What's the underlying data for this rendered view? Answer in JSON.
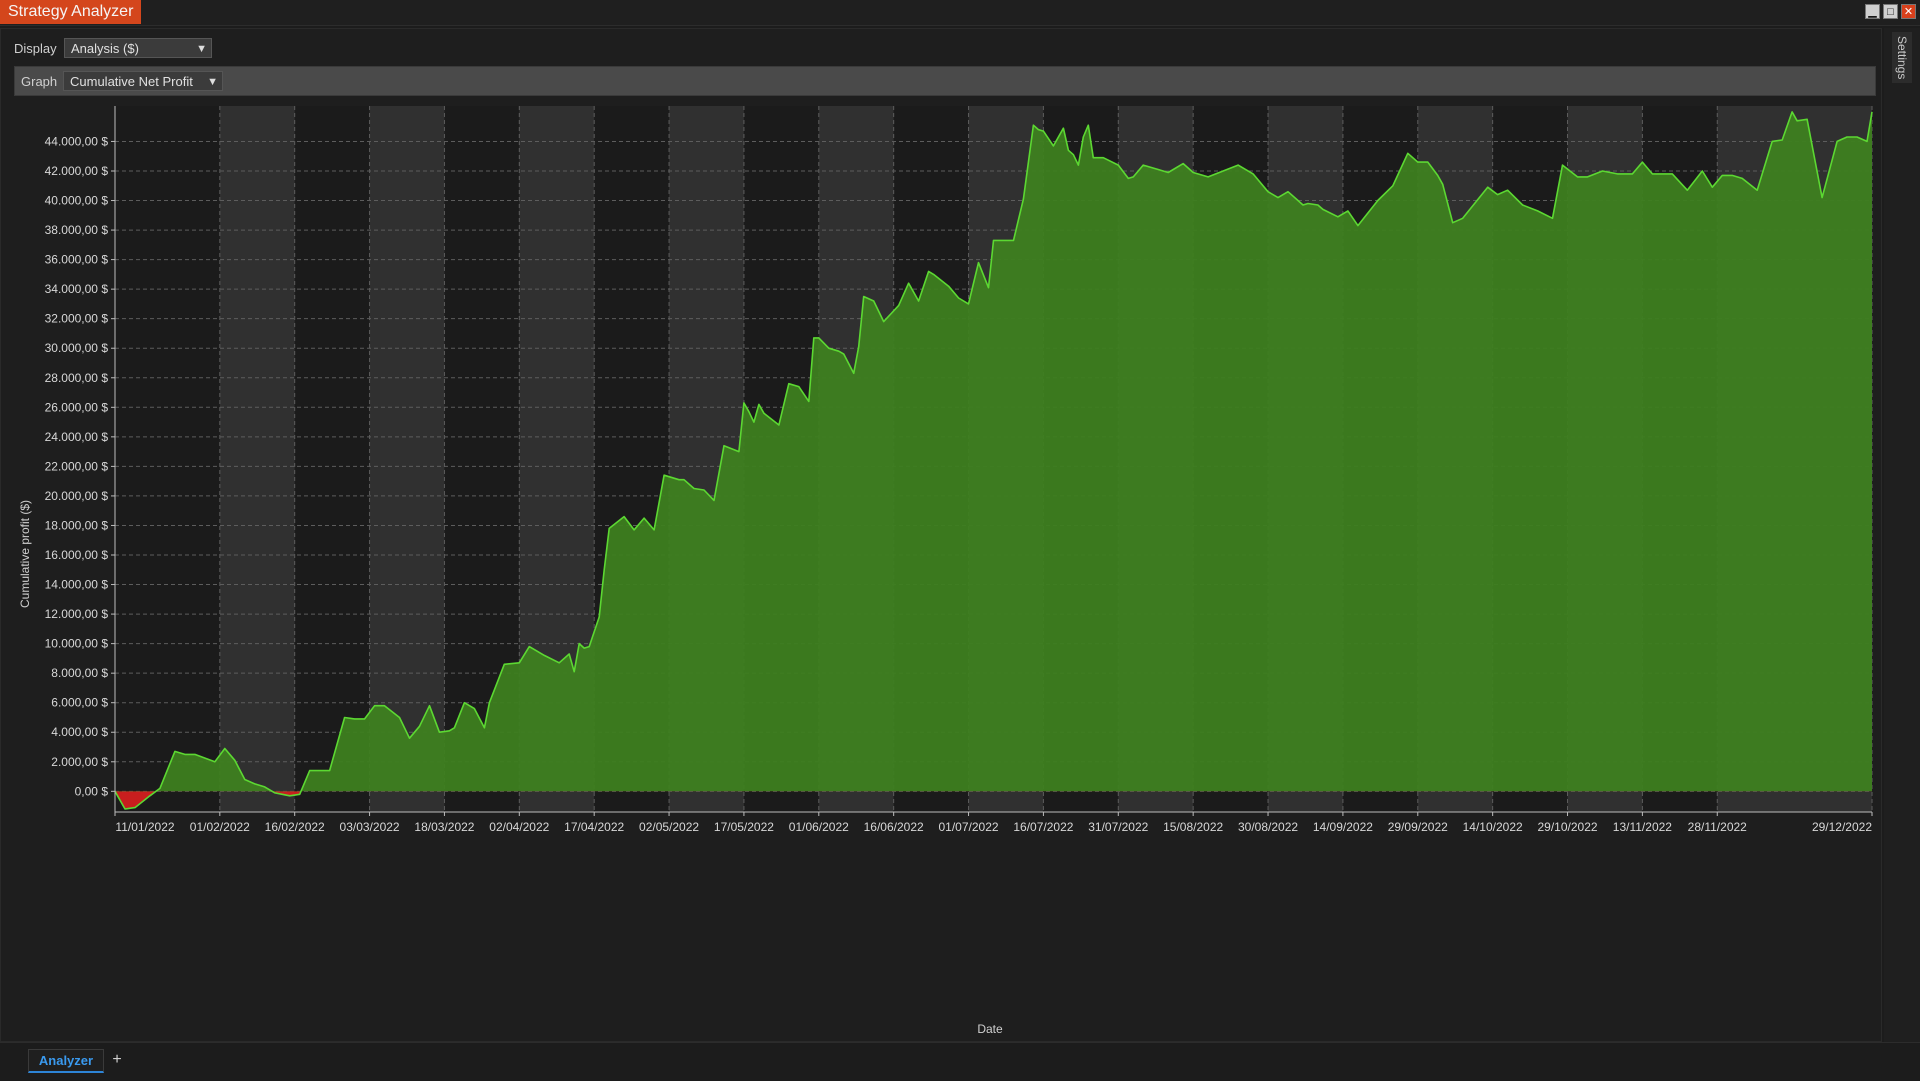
{
  "window": {
    "title": "Strategy Analyzer",
    "minimize_glyph": "▁",
    "maximize_glyph": "□",
    "close_glyph": "✕"
  },
  "side_panel": {
    "label": "Settings"
  },
  "display": {
    "label": "Display",
    "value": "Analysis ($)"
  },
  "graph": {
    "label": "Graph",
    "value": "Cumulative Net Profit"
  },
  "tabs": {
    "active": "Analyzer",
    "add": "+"
  },
  "colors": {
    "fill": "#3e801f",
    "line": "#5cd832",
    "negative": "#c81e1e",
    "band_light": "#303030",
    "band_dark": "#1b1b1b",
    "accent": "#d4461c",
    "tab_text": "#3a9aef"
  },
  "chart_data": {
    "type": "area",
    "title": "",
    "xlabel": "Date",
    "ylabel": "Cumulative profit ($)",
    "ylim": [
      -1400,
      46400
    ],
    "grid": true,
    "y_ticks": [
      "0,00 $",
      "2.000,00 $",
      "4.000,00 $",
      "6.000,00 $",
      "8.000,00 $",
      "10.000,00 $",
      "12.000,00 $",
      "14.000,00 $",
      "16.000,00 $",
      "18.000,00 $",
      "20.000,00 $",
      "22.000,00 $",
      "24.000,00 $",
      "26.000,00 $",
      "28.000,00 $",
      "30.000,00 $",
      "32.000,00 $",
      "34.000,00 $",
      "36.000,00 $",
      "38.000,00 $",
      "40.000,00 $",
      "42.000,00 $",
      "44.000,00 $"
    ],
    "x_ticks": [
      "11/01/2022",
      "01/02/2022",
      "16/02/2022",
      "03/03/2022",
      "18/03/2022",
      "02/04/2022",
      "17/04/2022",
      "02/05/2022",
      "17/05/2022",
      "01/06/2022",
      "16/06/2022",
      "01/07/2022",
      "16/07/2022",
      "31/07/2022",
      "15/08/2022",
      "30/08/2022",
      "14/09/2022",
      "29/09/2022",
      "14/10/2022",
      "29/10/2022",
      "13/11/2022",
      "28/11/2022",
      "29/12/2022"
    ],
    "x": [
      "11/01/2022",
      "13/01/2022",
      "15/01/2022",
      "18/01/2022",
      "20/01/2022",
      "23/01/2022",
      "25/01/2022",
      "26/01/2022",
      "27/01/2022",
      "31/01/2022",
      "02/02/2022",
      "04/02/2022",
      "06/02/2022",
      "08/02/2022",
      "10/02/2022",
      "12/02/2022",
      "15/02/2022",
      "17/02/2022",
      "19/02/2022",
      "21/02/2022",
      "23/02/2022",
      "26/02/2022",
      "28/02/2022",
      "02/03/2022",
      "04/03/2022",
      "06/03/2022",
      "09/03/2022",
      "11/03/2022",
      "13/03/2022",
      "15/03/2022",
      "17/03/2022",
      "19/03/2022",
      "20/03/2022",
      "22/03/2022",
      "24/03/2022",
      "26/03/2022",
      "27/03/2022",
      "30/03/2022",
      "02/04/2022",
      "04/04/2022",
      "07/04/2022",
      "10/04/2022",
      "12/04/2022",
      "13/04/2022",
      "14/04/2022",
      "15/04/2022",
      "16/04/2022",
      "18/04/2022",
      "19/04/2022",
      "20/04/2022",
      "23/04/2022",
      "25/04/2022",
      "27/04/2022",
      "29/04/2022",
      "01/05/2022",
      "03/05/2022",
      "04/05/2022",
      "05/05/2022",
      "07/05/2022",
      "09/05/2022",
      "11/05/2022",
      "13/05/2022",
      "16/05/2022",
      "17/05/2022",
      "18/05/2022",
      "19/05/2022",
      "20/05/2022",
      "21/05/2022",
      "24/05/2022",
      "26/05/2022",
      "28/05/2022",
      "30/05/2022",
      "31/05/2022",
      "01/06/2022",
      "03/06/2022",
      "05/06/2022",
      "06/06/2022",
      "08/06/2022",
      "09/06/2022",
      "10/06/2022",
      "12/06/2022",
      "14/06/2022",
      "17/06/2022",
      "19/06/2022",
      "21/06/2022",
      "23/06/2022",
      "24/06/2022",
      "27/06/2022",
      "29/06/2022",
      "01/07/2022",
      "03/07/2022",
      "05/07/2022",
      "06/07/2022",
      "08/07/2022",
      "10/07/2022",
      "12/07/2022",
      "14/07/2022",
      "15/07/2022",
      "16/07/2022",
      "18/07/2022",
      "20/07/2022",
      "21/07/2022",
      "22/07/2022",
      "23/07/2022",
      "24/07/2022",
      "25/07/2022",
      "26/07/2022",
      "28/07/2022",
      "31/07/2022",
      "02/08/2022",
      "03/08/2022",
      "05/08/2022",
      "08/08/2022",
      "10/08/2022",
      "13/08/2022",
      "15/08/2022",
      "18/08/2022",
      "24/08/2022",
      "27/08/2022",
      "30/08/2022",
      "01/09/2022",
      "03/09/2022",
      "05/09/2022",
      "06/09/2022",
      "07/09/2022",
      "09/09/2022",
      "10/09/2022",
      "13/09/2022",
      "15/09/2022",
      "17/09/2022",
      "21/09/2022",
      "24/09/2022",
      "27/09/2022",
      "29/09/2022",
      "01/10/2022",
      "03/10/2022",
      "04/10/2022",
      "06/10/2022",
      "08/10/2022",
      "13/10/2022",
      "15/10/2022",
      "17/10/2022",
      "20/10/2022",
      "23/10/2022",
      "26/10/2022",
      "28/10/2022",
      "31/10/2022",
      "02/11/2022",
      "05/11/2022",
      "08/11/2022",
      "11/11/2022",
      "13/11/2022",
      "15/11/2022",
      "19/11/2022",
      "22/11/2022",
      "25/11/2022",
      "27/11/2022",
      "29/11/2022",
      "01/12/2022",
      "03/12/2022",
      "06/12/2022",
      "09/12/2022",
      "11/12/2022",
      "13/12/2022",
      "14/12/2022",
      "16/12/2022",
      "19/12/2022",
      "22/12/2022",
      "24/12/2022",
      "26/12/2022",
      "28/12/2022",
      "29/12/2022"
    ],
    "values": [
      0,
      -1200,
      -1100,
      -300,
      200,
      2700,
      2500,
      2500,
      2500,
      2000,
      2900,
      2100,
      800,
      500,
      300,
      -100,
      -300,
      -200,
      1400,
      1400,
      1400,
      5000,
      4900,
      4900,
      5800,
      5800,
      5000,
      3600,
      4400,
      5800,
      4000,
      4100,
      4300,
      6000,
      5600,
      4300,
      6000,
      8600,
      8700,
      9800,
      9200,
      8700,
      9300,
      8100,
      10000,
      9700,
      9800,
      11800,
      15000,
      17800,
      18600,
      17700,
      18500,
      17700,
      21400,
      21200,
      21100,
      21100,
      20500,
      20400,
      19700,
      23400,
      23000,
      26300,
      25700,
      25000,
      26200,
      25600,
      24800,
      27600,
      27400,
      26400,
      30700,
      30700,
      30000,
      29800,
      29600,
      28300,
      30100,
      33500,
      33200,
      31800,
      32900,
      34400,
      33200,
      35200,
      35000,
      34200,
      33400,
      33000,
      35800,
      34100,
      37300,
      37300,
      37300,
      40100,
      45100,
      44800,
      44700,
      43700,
      44900,
      43400,
      43100,
      42400,
      44300,
      45100,
      42900,
      42900,
      42400,
      41500,
      41600,
      42400,
      42100,
      41900,
      42500,
      41900,
      41600,
      42400,
      41800,
      40600,
      40200,
      40600,
      40000,
      39700,
      39800,
      39700,
      39400,
      38900,
      39300,
      38300,
      40000,
      41000,
      43200,
      42600,
      42600,
      41700,
      41100,
      38500,
      38800,
      40900,
      40400,
      40700,
      39700,
      39300,
      38800,
      42400,
      41600,
      41600,
      42000,
      41800,
      41800,
      42600,
      41800,
      41800,
      40700,
      42000,
      40900,
      41700,
      41700,
      41500,
      40700,
      44000,
      44100,
      46000,
      45400,
      45500,
      40200,
      44000,
      44300,
      44300,
      44000,
      46000
    ]
  }
}
